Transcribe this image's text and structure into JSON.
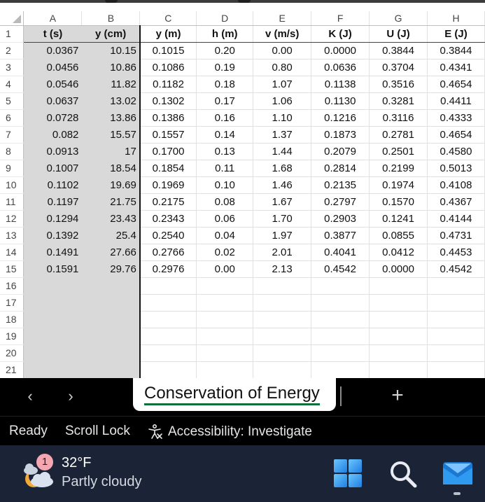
{
  "columns": [
    "A",
    "B",
    "C",
    "D",
    "E",
    "F",
    "G",
    "H"
  ],
  "header_row": [
    "t (s)",
    "y (cm)",
    "y (m)",
    "h (m)",
    "v (m/s)",
    "K (J)",
    "U (J)",
    "E (J)"
  ],
  "rows": [
    [
      "0.0367",
      "10.15",
      "0.1015",
      "0.20",
      "0.00",
      "0.0000",
      "0.3844",
      "0.3844"
    ],
    [
      "0.0456",
      "10.86",
      "0.1086",
      "0.19",
      "0.80",
      "0.0636",
      "0.3704",
      "0.4341"
    ],
    [
      "0.0546",
      "11.82",
      "0.1182",
      "0.18",
      "1.07",
      "0.1138",
      "0.3516",
      "0.4654"
    ],
    [
      "0.0637",
      "13.02",
      "0.1302",
      "0.17",
      "1.06",
      "0.1130",
      "0.3281",
      "0.4411"
    ],
    [
      "0.0728",
      "13.86",
      "0.1386",
      "0.16",
      "1.10",
      "0.1216",
      "0.3116",
      "0.4333"
    ],
    [
      "0.082",
      "15.57",
      "0.1557",
      "0.14",
      "1.37",
      "0.1873",
      "0.2781",
      "0.4654"
    ],
    [
      "0.0913",
      "17",
      "0.1700",
      "0.13",
      "1.44",
      "0.2079",
      "0.2501",
      "0.4580"
    ],
    [
      "0.1007",
      "18.54",
      "0.1854",
      "0.11",
      "1.68",
      "0.2814",
      "0.2199",
      "0.5013"
    ],
    [
      "0.1102",
      "19.69",
      "0.1969",
      "0.10",
      "1.46",
      "0.2135",
      "0.1974",
      "0.4108"
    ],
    [
      "0.1197",
      "21.75",
      "0.2175",
      "0.08",
      "1.67",
      "0.2797",
      "0.1570",
      "0.4367"
    ],
    [
      "0.1294",
      "23.43",
      "0.2343",
      "0.06",
      "1.70",
      "0.2903",
      "0.1241",
      "0.4144"
    ],
    [
      "0.1392",
      "25.4",
      "0.2540",
      "0.04",
      "1.97",
      "0.3877",
      "0.0855",
      "0.4731"
    ],
    [
      "0.1491",
      "27.66",
      "0.2766",
      "0.02",
      "2.01",
      "0.4041",
      "0.0412",
      "0.4453"
    ],
    [
      "0.1591",
      "29.76",
      "0.2976",
      "0.00",
      "2.13",
      "0.4542",
      "0.0000",
      "0.4542"
    ]
  ],
  "row_numbers": [
    "1",
    "2",
    "3",
    "4",
    "5",
    "6",
    "7",
    "8",
    "9",
    "10",
    "11",
    "12",
    "13",
    "14",
    "15",
    "16",
    "17",
    "18",
    "19",
    "20",
    "21"
  ],
  "sheet_tabs": {
    "active": "Conservation of Energy",
    "prev_icon": "chevron-left-icon",
    "next_icon": "chevron-right-icon",
    "add_icon": "plus-icon"
  },
  "status_bar": {
    "ready": "Ready",
    "scroll_lock": "Scroll Lock",
    "accessibility": "Accessibility: Investigate"
  },
  "taskbar": {
    "weather_badge": "1",
    "temperature": "32°F",
    "condition": "Partly cloudy",
    "icons": [
      "weather-icon",
      "windows-start-icon",
      "search-icon",
      "mail-icon"
    ]
  },
  "colors": {
    "selected_fill": "#d9d9d9",
    "tab_underline": "#0f6e3a",
    "taskbar": "#1b2436",
    "start_blue": "#3aa0f0"
  }
}
